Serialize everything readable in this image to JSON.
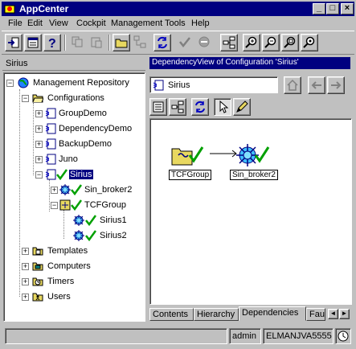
{
  "window": {
    "title": "AppCenter"
  },
  "menu": [
    "File",
    "Edit",
    "View",
    "Cockpit",
    "Management",
    "Tools",
    "Help"
  ],
  "left_panel": {
    "header": "Sirius"
  },
  "tree": {
    "root": "Management Repository",
    "configurations": "Configurations",
    "group_demo": "GroupDemo",
    "dependency_demo": "DependencyDemo",
    "backup_demo": "BackupDemo",
    "juno": "Juno",
    "sirius": "Sirius",
    "sin_broker2": "Sin_broker2",
    "tcf_group": "TCFGroup",
    "sirius1": "Sirius1",
    "sirius2": "Sirius2",
    "templates": "Templates",
    "computers": "Computers",
    "timers": "Timers",
    "users": "Users"
  },
  "right_panel": {
    "header": "DependencyView of Configuration 'Sirius'",
    "path": "Sirius",
    "nodes": [
      "TCFGroup",
      "Sin_broker2"
    ]
  },
  "tabs": [
    "Contents",
    "Hierarchy",
    "Dependencies",
    "Fau"
  ],
  "status": {
    "message": "",
    "user": "admin",
    "host": "ELMANJVA5555"
  },
  "colors": {
    "titlebar": "#000080",
    "face": "#c0c0c0",
    "check": "#00a000",
    "folder": "#e8d860"
  }
}
